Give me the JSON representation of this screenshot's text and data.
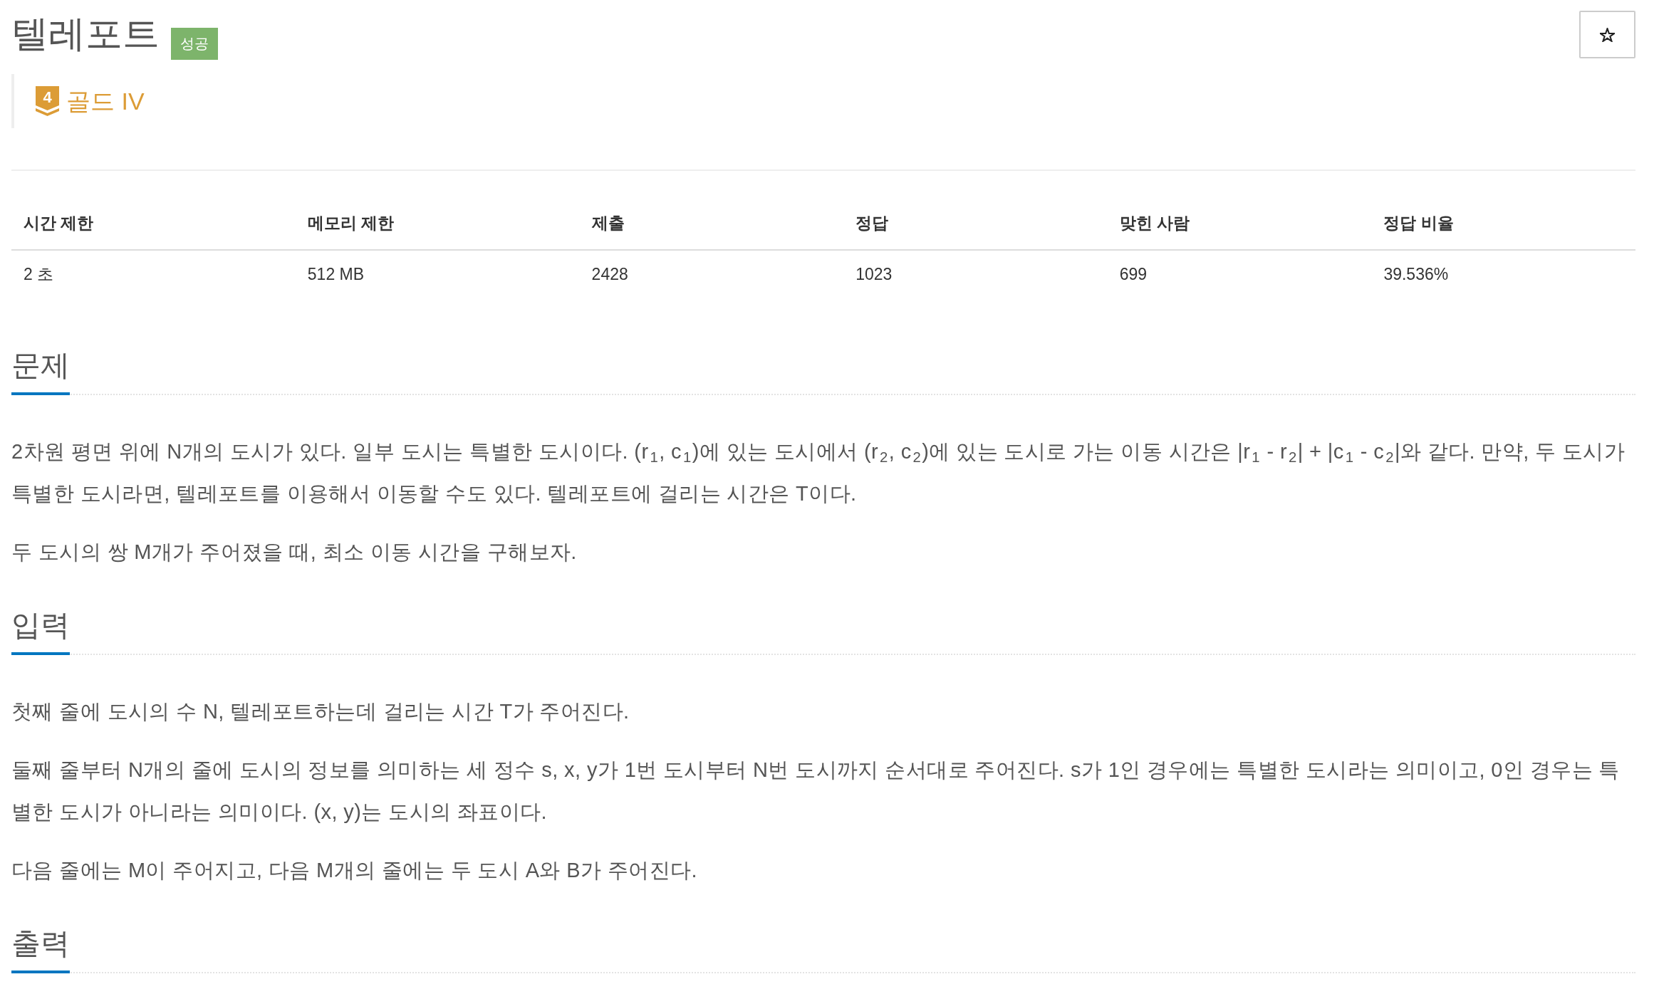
{
  "problem": {
    "title": "텔레포트",
    "result_badge": "성공"
  },
  "favorite_button": {
    "starred": false
  },
  "tier": {
    "number": "4",
    "label": "골드 IV"
  },
  "info_table": {
    "columns": [
      "시간 제한",
      "메모리 제한",
      "제출",
      "정답",
      "맞힌 사람",
      "정답 비율"
    ],
    "rows": [
      [
        "2 초",
        "512 MB",
        "2428",
        "1023",
        "699",
        "39.536%"
      ]
    ]
  },
  "sections": [
    {
      "heading": "문제",
      "paragraphs": [
        "2차원 평면 위에 N개의 도시가 있다. 일부 도시는 특별한 도시이다. (r$_{1}$, c$_{1}$)에 있는 도시에서 (r$_{2}$, c$_{2}$)에 있는 도시로 가는 이동 시간은 |r$_{1}$ - r$_{2}$| + |c$_{1}$ - c$_{2}$|와 같다. 만약, 두 도시가 특별한 도시라면, 텔레포트를 이용해서 이동할 수도 있다. 텔레포트에 걸리는 시간은 T이다.",
        "두 도시의 쌍 M개가 주어졌을 때, 최소 이동 시간을 구해보자."
      ]
    },
    {
      "heading": "입력",
      "paragraphs": [
        "첫째 줄에 도시의 수 N, 텔레포트하는데 걸리는 시간 T가 주어진다.",
        "둘째 줄부터 N개의 줄에 도시의 정보를 의미하는 세 정수 s, x, y가 1번 도시부터 N번 도시까지 순서대로 주어진다. s가 1인 경우에는 특별한 도시라는 의미이고, 0인 경우는 특별한 도시가 아니라는 의미이다. (x, y)는 도시의 좌표이다.",
        "다음 줄에는 M이 주어지고, 다음 M개의 줄에는 두 도시 A와 B가 주어진다."
      ]
    },
    {
      "heading": "출력"
    }
  ]
}
